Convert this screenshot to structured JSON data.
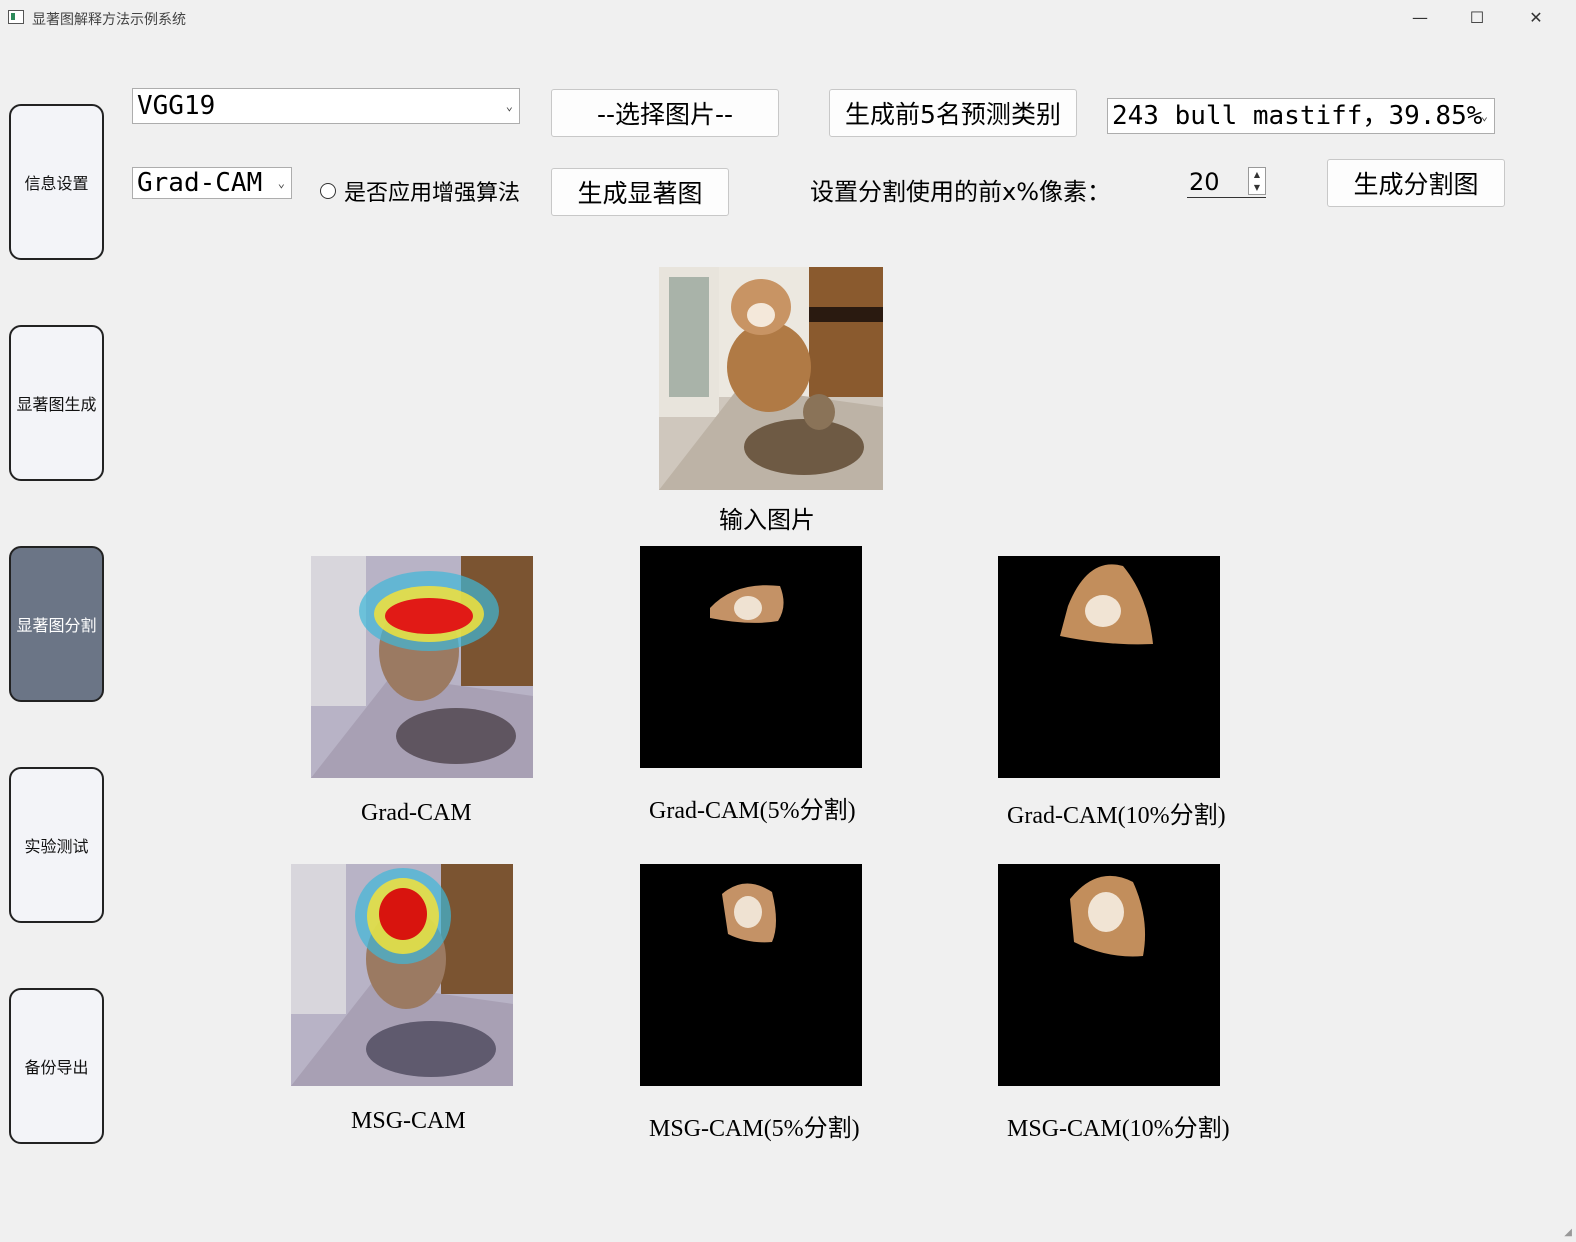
{
  "window": {
    "title": "显著图解释方法示例系统",
    "minimize": "—",
    "maximize": "☐",
    "close": "✕"
  },
  "sidebar": {
    "items": [
      {
        "label": "信息设置",
        "active": false
      },
      {
        "label": "显著图生成",
        "active": false
      },
      {
        "label": "显著图分割",
        "active": true
      },
      {
        "label": "实验测试",
        "active": false
      },
      {
        "label": "备份导出",
        "active": false
      }
    ]
  },
  "controls": {
    "model_select": {
      "value": "VGG19",
      "arrow": "⌄"
    },
    "method_select": {
      "value": "Grad-CAM",
      "arrow": "⌄"
    },
    "enhance_radio_label": "是否应用增强算法",
    "select_image_button": "--选择图片--",
    "generate_saliency_button": "生成显著图",
    "top5_button": "生成前5名预测类别",
    "prediction_select": {
      "value": "243 bull mastiff，39.85%",
      "arrow": "⌄"
    },
    "segmentation_label": "设置分割使用的前x%像素：",
    "segmentation_value": "20",
    "generate_segmentation_button": "生成分割图"
  },
  "images": {
    "input_caption": "输入图片",
    "row1": [
      "Grad-CAM",
      "Grad-CAM(5%分割)",
      "Grad-CAM(10%分割)"
    ],
    "row2": [
      "MSG-CAM",
      "MSG-CAM(5%分割)",
      "MSG-CAM(10%分割)"
    ]
  },
  "colors": {
    "sidebar_active": "#6b7586",
    "sidebar_bg": "#f3f4f8",
    "window_bg": "#f0f0f0"
  }
}
